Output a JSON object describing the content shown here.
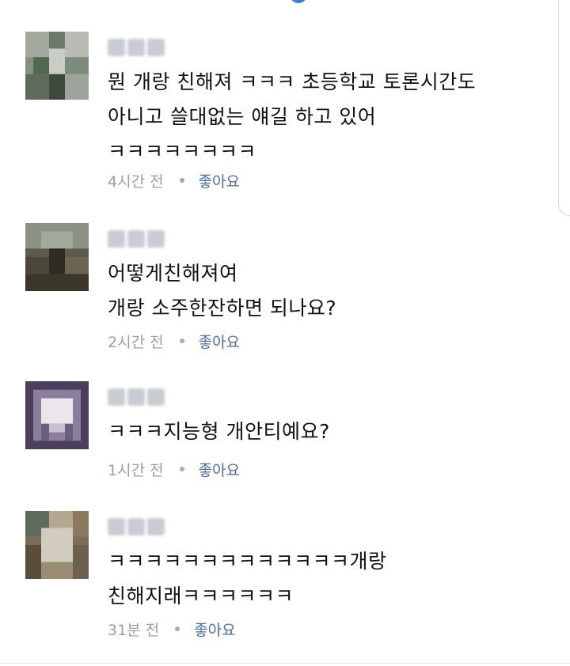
{
  "colors": {
    "accent": "#3b7dd8",
    "like_link": "#4a6ea8",
    "meta_text": "#9a9ea5",
    "body_text": "#111111"
  },
  "comments": [
    {
      "text": "뭔 개랑 친해져 ㅋㅋㅋ 초등학교 토론시간도\n아니고 쓸대없는 얘길 하고 있어\nㅋㅋㅋㅋㅋㅋㅋㅋ",
      "time": "4시간 전",
      "like_label": "좋아요"
    },
    {
      "text": "어떻게친해져여\n개랑 소주한잔하면 되나요?",
      "time": "2시간 전",
      "like_label": "좋아요"
    },
    {
      "text": "ㅋㅋㅋ지능형 개안티예요?",
      "time": "1시간 전",
      "like_label": "좋아요"
    },
    {
      "text": "ㅋㅋㅋㅋㅋㅋㅋㅋㅋㅋㅋㅋㅋ개랑\n친해지래ㅋㅋㅋㅋㅋㅋ",
      "time": "31분 전",
      "like_label": "좋아요"
    }
  ]
}
